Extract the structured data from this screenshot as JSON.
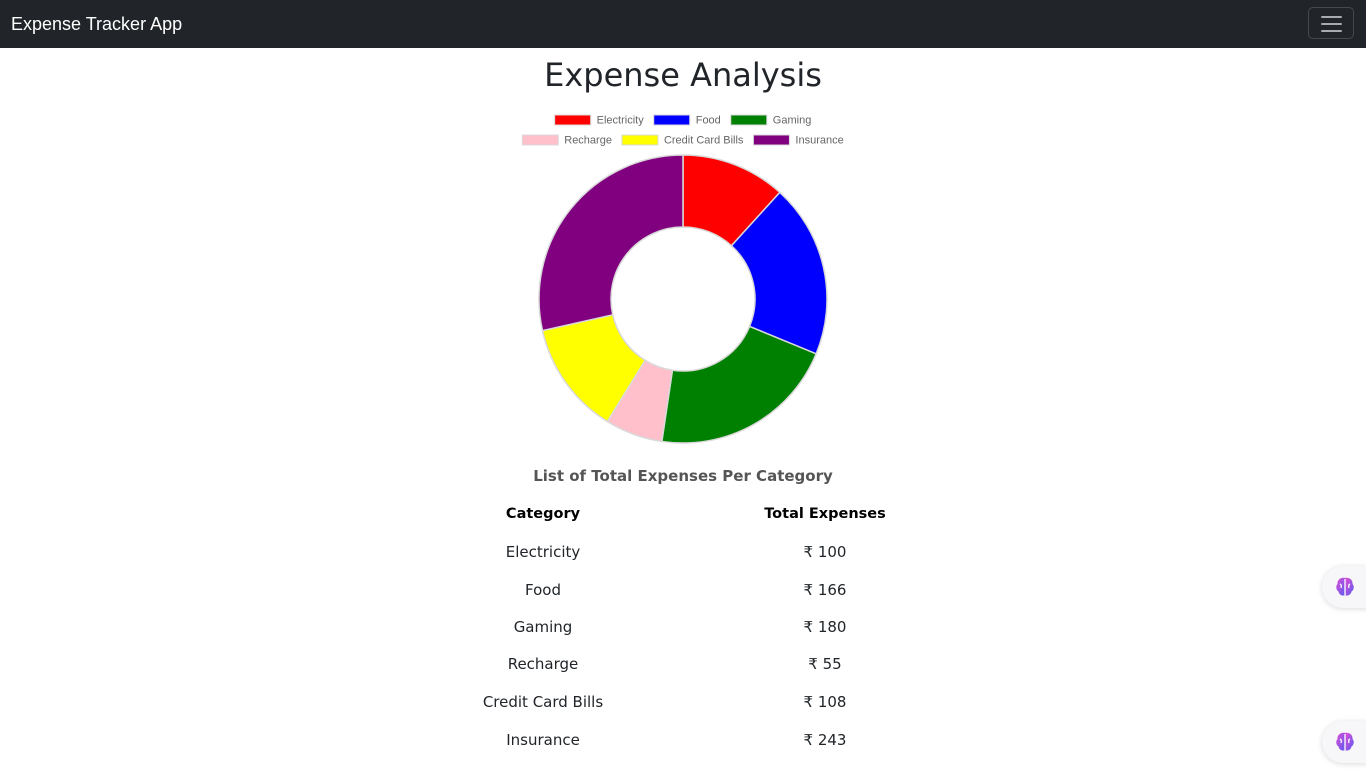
{
  "navbar": {
    "brand": "Expense Tracker App",
    "toggler_icon": "hamburger-menu-icon"
  },
  "page": {
    "title": "Expense Analysis"
  },
  "chart_data": {
    "type": "pie",
    "variant": "doughnut",
    "categories": [
      "Electricity",
      "Food",
      "Gaming",
      "Recharge",
      "Credit Card Bills",
      "Insurance"
    ],
    "values": [
      100,
      166,
      180,
      55,
      108,
      243
    ],
    "colors": [
      "#ff0000",
      "#0000ff",
      "#008000",
      "#ffc0cb",
      "#ffff00",
      "#800080"
    ],
    "legend_position": "top"
  },
  "summary": {
    "title": "List of Total Expenses Per Category",
    "headers": {
      "category": "Category",
      "total": "Total Expenses"
    },
    "rows": [
      {
        "category": "Electricity",
        "total": "₹ 100"
      },
      {
        "category": "Food",
        "total": "₹ 166"
      },
      {
        "category": "Gaming",
        "total": "₹ 180"
      },
      {
        "category": "Recharge",
        "total": "₹ 55"
      },
      {
        "category": "Credit Card Bills",
        "total": "₹ 108"
      },
      {
        "category": "Insurance",
        "total": "₹ 243"
      }
    ]
  },
  "floating_buttons": [
    {
      "icon": "brain-assistant-icon"
    },
    {
      "icon": "brain-assistant-icon"
    }
  ]
}
